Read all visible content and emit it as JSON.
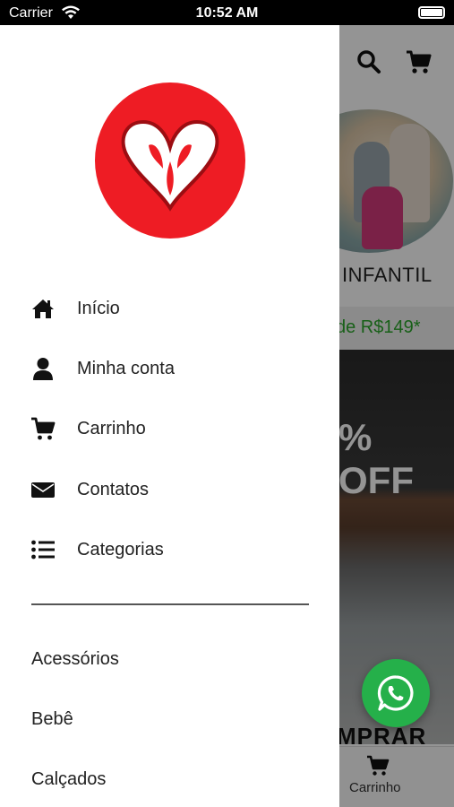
{
  "status_bar": {
    "carrier": "Carrier",
    "time": "10:52 AM"
  },
  "drawer": {
    "logo": "brand-logo-heart",
    "menu": [
      {
        "label": "Início",
        "icon": "home-icon"
      },
      {
        "label": "Minha conta",
        "icon": "user-icon"
      },
      {
        "label": "Carrinho",
        "icon": "cart-icon"
      },
      {
        "label": "Contatos",
        "icon": "envelope-icon"
      },
      {
        "label": "Categorias",
        "icon": "list-icon"
      }
    ],
    "categories": [
      "Acessórios",
      "Bebê",
      "Calçados"
    ]
  },
  "background_app": {
    "category_label": "INFANTIL",
    "promo_text": "de R$149*",
    "hero_text": "% OFF",
    "hero_cta": "MPRAR",
    "tab_cart_label": "Carrinho"
  },
  "colors": {
    "brand_red": "#ee1c24",
    "whatsapp_green": "#25b04a",
    "promo_green": "#2aa52a"
  }
}
